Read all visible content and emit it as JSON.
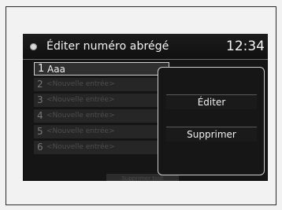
{
  "header": {
    "title": "Éditer numéro abrégé",
    "clock": "12:34"
  },
  "list": {
    "items": [
      {
        "number": "1",
        "label": "Aaa"
      },
      {
        "number": "2",
        "label": "<Nouvelle entrée>"
      },
      {
        "number": "3",
        "label": "<Nouvelle entrée>"
      },
      {
        "number": "4",
        "label": "<Nouvelle entrée>"
      },
      {
        "number": "5",
        "label": "<Nouvelle entrée>"
      },
      {
        "number": "6",
        "label": "<Nouvelle entrée>"
      }
    ]
  },
  "popup": {
    "edit_label": "Éditer",
    "delete_label": "Supprimer"
  },
  "footer": {
    "tab_label": "Supprimer tout"
  },
  "colors": {
    "screen_bg": "#151515",
    "text_primary": "#f0f0f0",
    "text_dim": "#4e4e4e",
    "frame_border": "#2b2b2b"
  },
  "icons": {
    "title_icon": "phone-icon"
  }
}
